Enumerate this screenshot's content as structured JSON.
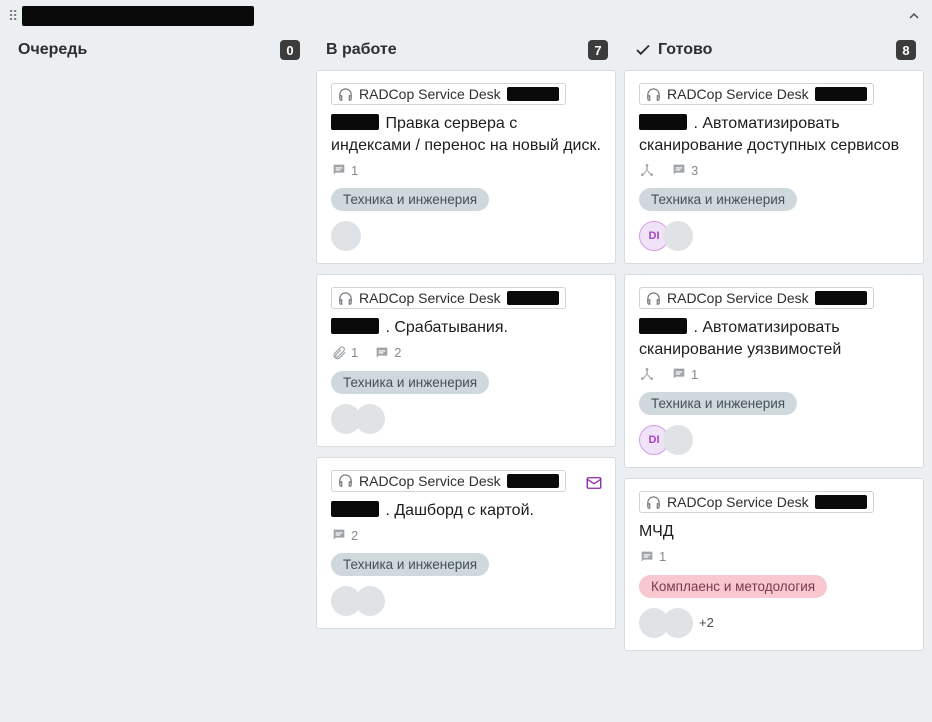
{
  "columns": [
    {
      "id": "queue",
      "title": "Очередь",
      "count": "0",
      "has_check": false
    },
    {
      "id": "progress",
      "title": "В работе",
      "count": "7",
      "has_check": false
    },
    {
      "id": "done",
      "title": "Готово",
      "count": "8",
      "has_check": true
    }
  ],
  "project_name": "RADCop Service Desk",
  "cards": {
    "progress": [
      {
        "title_after_key": "Правка сервера с индексами / перенос на новый диск.",
        "comments": "1",
        "attachments": null,
        "subtasks": false,
        "tag": {
          "text": "Техника и инженерия",
          "kind": "tech"
        },
        "avatars": [
          {
            "kind": "plain"
          }
        ],
        "more": null,
        "mail": false
      },
      {
        "title_after_key": ". Срабатывания.",
        "comments": "2",
        "attachments": "1",
        "subtasks": false,
        "tag": {
          "text": "Техника и инженерия",
          "kind": "tech"
        },
        "avatars": [
          {
            "kind": "plain"
          },
          {
            "kind": "plain"
          }
        ],
        "more": null,
        "mail": false
      },
      {
        "title_after_key": ". Дашборд с картой.",
        "comments": "2",
        "attachments": null,
        "subtasks": false,
        "tag": {
          "text": "Техника и инженерия",
          "kind": "tech"
        },
        "avatars": [
          {
            "kind": "plain"
          },
          {
            "kind": "plain"
          }
        ],
        "more": null,
        "mail": true
      }
    ],
    "done": [
      {
        "title_after_key": ". Автоматизировать сканирование доступных сервисов",
        "comments": "3",
        "attachments": null,
        "subtasks": true,
        "tag": {
          "text": "Техника и инженерия",
          "kind": "tech"
        },
        "avatars": [
          {
            "kind": "di",
            "initials": "DI"
          },
          {
            "kind": "plain"
          }
        ],
        "more": null,
        "mail": false
      },
      {
        "title_after_key": ". Автоматизировать сканирование уязвимостей",
        "comments": "1",
        "attachments": null,
        "subtasks": true,
        "tag": {
          "text": "Техника и инженерия",
          "kind": "tech"
        },
        "avatars": [
          {
            "kind": "di",
            "initials": "DI"
          },
          {
            "kind": "plain"
          }
        ],
        "more": null,
        "mail": false
      },
      {
        "title_after_key_no_redact": "МЧД",
        "comments": "1",
        "attachments": null,
        "subtasks": false,
        "tag": {
          "text": "Комплаенс и методология",
          "kind": "comp"
        },
        "avatars": [
          {
            "kind": "plain"
          },
          {
            "kind": "plain"
          }
        ],
        "more": "+2",
        "mail": false
      }
    ]
  }
}
